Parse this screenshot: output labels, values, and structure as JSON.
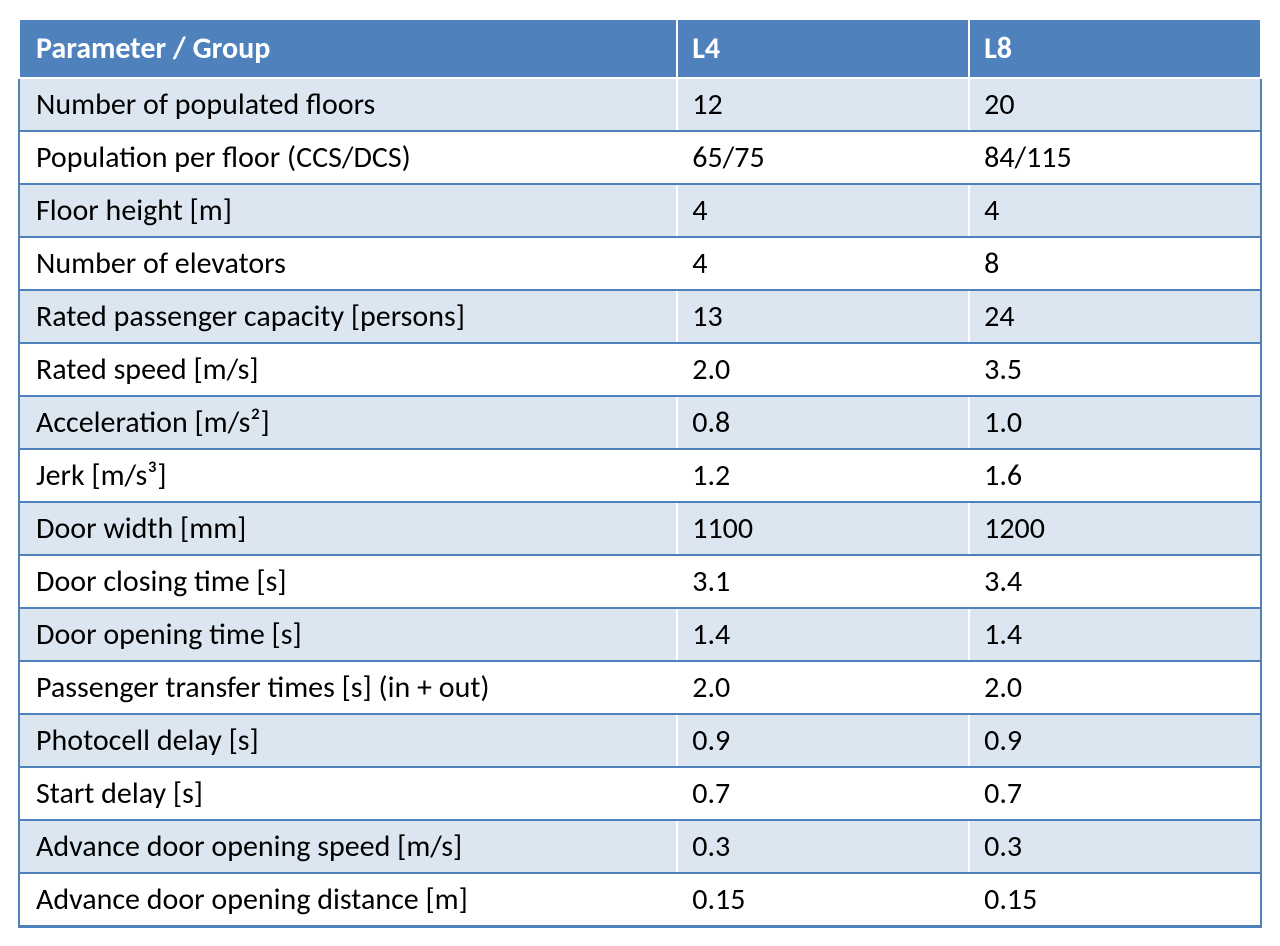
{
  "chart_data": {
    "type": "table",
    "columns": [
      "Parameter / Group",
      "L4",
      "L8"
    ],
    "rows": [
      [
        "Number of populated floors",
        "12",
        "20"
      ],
      [
        "Population per floor (CCS/DCS)",
        "65/75",
        "84/115"
      ],
      [
        "Floor height [m]",
        "4",
        "4"
      ],
      [
        "Number of elevators",
        "4",
        "8"
      ],
      [
        "Rated passenger capacity [persons]",
        "13",
        "24"
      ],
      [
        "Rated speed [m/s]",
        "2.0",
        "3.5"
      ],
      [
        "Acceleration [m/s²]",
        "0.8",
        "1.0"
      ],
      [
        "Jerk [m/s³]",
        "1.2",
        "1.6"
      ],
      [
        "Door width [mm]",
        "1100",
        "1200"
      ],
      [
        "Door closing time [s]",
        "3.1",
        "3.4"
      ],
      [
        "Door opening time [s]",
        "1.4",
        "1.4"
      ],
      [
        "Passenger transfer times [s] (in + out)",
        "2.0",
        "2.0"
      ],
      [
        "Photocell delay [s]",
        "0.9",
        "0.9"
      ],
      [
        "Start delay [s]",
        "0.7",
        "0.7"
      ],
      [
        "Advance door opening speed [m/s]",
        "0.3",
        "0.3"
      ],
      [
        "Advance door opening distance [m]",
        "0.15",
        "0.15"
      ]
    ]
  }
}
